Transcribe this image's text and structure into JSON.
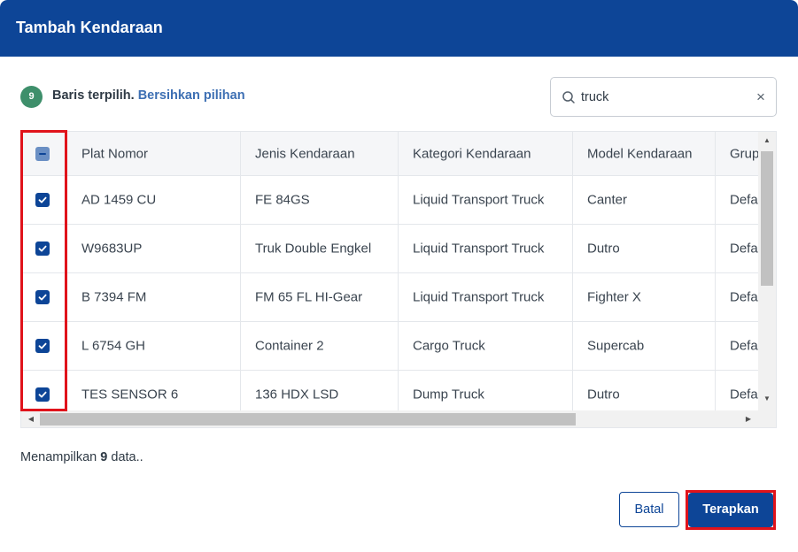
{
  "modal": {
    "title": "Tambah Kendaraan"
  },
  "selection": {
    "count": "9",
    "text": "Baris terpilih.",
    "clear_link": "Bersihkan pilihan"
  },
  "search": {
    "value": "truck",
    "clear_icon": "×"
  },
  "table": {
    "headers": [
      "Plat Nomor",
      "Jenis Kendaraan",
      "Kategori Kendaraan",
      "Model Kendaraan",
      "Grup"
    ],
    "rows": [
      {
        "checked": true,
        "plat": "AD 1459 CU",
        "jenis": "FE 84GS",
        "kategori": "Liquid Transport Truck",
        "model": "Canter",
        "grup": "Default"
      },
      {
        "checked": true,
        "plat": "W9683UP",
        "jenis": "Truk Double Engkel",
        "kategori": "Liquid Transport Truck",
        "model": "Dutro",
        "grup": "Default"
      },
      {
        "checked": true,
        "plat": "B 7394 FM",
        "jenis": "FM 65 FL HI-Gear",
        "kategori": "Liquid Transport Truck",
        "model": "Fighter X",
        "grup": "Default"
      },
      {
        "checked": true,
        "plat": "L 6754 GH",
        "jenis": "Container 2",
        "kategori": "Cargo Truck",
        "model": "Supercab",
        "grup": "Default"
      },
      {
        "checked": true,
        "plat": "TES SENSOR 6",
        "jenis": "136 HDX LSD",
        "kategori": "Dump Truck",
        "model": "Dutro",
        "grup": "Default"
      }
    ]
  },
  "footer": {
    "count_prefix": "Menampilkan",
    "count_value": "9",
    "count_suffix": "data..",
    "cancel_label": "Batal",
    "apply_label": "Terapkan"
  },
  "colors": {
    "primary": "#0d4597",
    "badge": "#3e8f6b",
    "link": "#3d6fb3",
    "highlight": "#e0131b"
  }
}
